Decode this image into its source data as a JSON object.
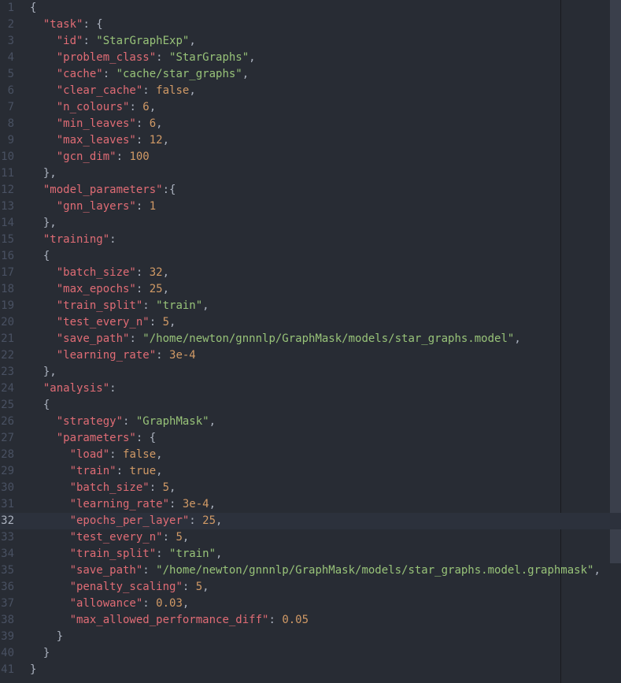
{
  "lines": [
    {
      "num": "1",
      "indent": 0,
      "tokens": [
        {
          "t": "{",
          "c": "p"
        }
      ]
    },
    {
      "num": "2",
      "indent": 1,
      "tokens": [
        {
          "t": "\"task\"",
          "c": "k"
        },
        {
          "t": ": {",
          "c": "p"
        }
      ]
    },
    {
      "num": "3",
      "indent": 2,
      "tokens": [
        {
          "t": "\"id\"",
          "c": "k"
        },
        {
          "t": ": ",
          "c": "p"
        },
        {
          "t": "\"StarGraphExp\"",
          "c": "s"
        },
        {
          "t": ",",
          "c": "p"
        }
      ]
    },
    {
      "num": "4",
      "indent": 2,
      "tokens": [
        {
          "t": "\"problem_class\"",
          "c": "k"
        },
        {
          "t": ": ",
          "c": "p"
        },
        {
          "t": "\"StarGraphs\"",
          "c": "s"
        },
        {
          "t": ",",
          "c": "p"
        }
      ]
    },
    {
      "num": "5",
      "indent": 2,
      "tokens": [
        {
          "t": "\"cache\"",
          "c": "k"
        },
        {
          "t": ": ",
          "c": "p"
        },
        {
          "t": "\"cache/star_graphs\"",
          "c": "s"
        },
        {
          "t": ",",
          "c": "p"
        }
      ]
    },
    {
      "num": "6",
      "indent": 2,
      "tokens": [
        {
          "t": "\"clear_cache\"",
          "c": "k"
        },
        {
          "t": ": ",
          "c": "p"
        },
        {
          "t": "false",
          "c": "n"
        },
        {
          "t": ",",
          "c": "p"
        }
      ]
    },
    {
      "num": "7",
      "indent": 2,
      "tokens": [
        {
          "t": "\"n_colours\"",
          "c": "k"
        },
        {
          "t": ": ",
          "c": "p"
        },
        {
          "t": "6",
          "c": "n"
        },
        {
          "t": ",",
          "c": "p"
        }
      ]
    },
    {
      "num": "8",
      "indent": 2,
      "tokens": [
        {
          "t": "\"min_leaves\"",
          "c": "k"
        },
        {
          "t": ": ",
          "c": "p"
        },
        {
          "t": "6",
          "c": "n"
        },
        {
          "t": ",",
          "c": "p"
        }
      ]
    },
    {
      "num": "9",
      "indent": 2,
      "tokens": [
        {
          "t": "\"max_leaves\"",
          "c": "k"
        },
        {
          "t": ": ",
          "c": "p"
        },
        {
          "t": "12",
          "c": "n"
        },
        {
          "t": ",",
          "c": "p"
        }
      ]
    },
    {
      "num": "10",
      "indent": 2,
      "tokens": [
        {
          "t": "\"gcn_dim\"",
          "c": "k"
        },
        {
          "t": ": ",
          "c": "p"
        },
        {
          "t": "100",
          "c": "n"
        }
      ]
    },
    {
      "num": "11",
      "indent": 1,
      "tokens": [
        {
          "t": "},",
          "c": "p"
        }
      ]
    },
    {
      "num": "12",
      "indent": 1,
      "tokens": [
        {
          "t": "\"model_parameters\"",
          "c": "k"
        },
        {
          "t": ":{",
          "c": "p"
        }
      ]
    },
    {
      "num": "13",
      "indent": 2,
      "tokens": [
        {
          "t": "\"gnn_layers\"",
          "c": "k"
        },
        {
          "t": ": ",
          "c": "p"
        },
        {
          "t": "1",
          "c": "n"
        }
      ]
    },
    {
      "num": "14",
      "indent": 1,
      "tokens": [
        {
          "t": "},",
          "c": "p"
        }
      ]
    },
    {
      "num": "15",
      "indent": 1,
      "tokens": [
        {
          "t": "\"training\"",
          "c": "k"
        },
        {
          "t": ":",
          "c": "p"
        }
      ]
    },
    {
      "num": "16",
      "indent": 1,
      "tokens": [
        {
          "t": "{",
          "c": "p"
        }
      ]
    },
    {
      "num": "17",
      "indent": 2,
      "tokens": [
        {
          "t": "\"batch_size\"",
          "c": "k"
        },
        {
          "t": ": ",
          "c": "p"
        },
        {
          "t": "32",
          "c": "n"
        },
        {
          "t": ",",
          "c": "p"
        }
      ]
    },
    {
      "num": "18",
      "indent": 2,
      "tokens": [
        {
          "t": "\"max_epochs\"",
          "c": "k"
        },
        {
          "t": ": ",
          "c": "p"
        },
        {
          "t": "25",
          "c": "n"
        },
        {
          "t": ",",
          "c": "p"
        }
      ]
    },
    {
      "num": "19",
      "indent": 2,
      "tokens": [
        {
          "t": "\"train_split\"",
          "c": "k"
        },
        {
          "t": ": ",
          "c": "p"
        },
        {
          "t": "\"train\"",
          "c": "s"
        },
        {
          "t": ",",
          "c": "p"
        }
      ]
    },
    {
      "num": "20",
      "indent": 2,
      "tokens": [
        {
          "t": "\"test_every_n\"",
          "c": "k"
        },
        {
          "t": ": ",
          "c": "p"
        },
        {
          "t": "5",
          "c": "n"
        },
        {
          "t": ",",
          "c": "p"
        }
      ]
    },
    {
      "num": "21",
      "indent": 2,
      "tokens": [
        {
          "t": "\"save_path\"",
          "c": "k"
        },
        {
          "t": ": ",
          "c": "p"
        },
        {
          "t": "\"/home/newton/gnnnlp/GraphMask/models/star_graphs.model\"",
          "c": "s"
        },
        {
          "t": ",",
          "c": "p"
        }
      ]
    },
    {
      "num": "22",
      "indent": 2,
      "tokens": [
        {
          "t": "\"learning_rate\"",
          "c": "k"
        },
        {
          "t": ": ",
          "c": "p"
        },
        {
          "t": "3e-4",
          "c": "n"
        }
      ]
    },
    {
      "num": "23",
      "indent": 1,
      "tokens": [
        {
          "t": "},",
          "c": "p"
        }
      ]
    },
    {
      "num": "24",
      "indent": 1,
      "tokens": [
        {
          "t": "\"analysis\"",
          "c": "k"
        },
        {
          "t": ":",
          "c": "p"
        }
      ]
    },
    {
      "num": "25",
      "indent": 1,
      "tokens": [
        {
          "t": "{",
          "c": "p"
        }
      ]
    },
    {
      "num": "26",
      "indent": 2,
      "tokens": [
        {
          "t": "\"strategy\"",
          "c": "k"
        },
        {
          "t": ": ",
          "c": "p"
        },
        {
          "t": "\"GraphMask\"",
          "c": "s"
        },
        {
          "t": ",",
          "c": "p"
        }
      ]
    },
    {
      "num": "27",
      "indent": 2,
      "tokens": [
        {
          "t": "\"parameters\"",
          "c": "k"
        },
        {
          "t": ": {",
          "c": "p"
        }
      ]
    },
    {
      "num": "28",
      "indent": 3,
      "tokens": [
        {
          "t": "\"load\"",
          "c": "k"
        },
        {
          "t": ": ",
          "c": "p"
        },
        {
          "t": "false",
          "c": "n"
        },
        {
          "t": ",",
          "c": "p"
        }
      ]
    },
    {
      "num": "29",
      "indent": 3,
      "tokens": [
        {
          "t": "\"train\"",
          "c": "k"
        },
        {
          "t": ": ",
          "c": "p"
        },
        {
          "t": "true",
          "c": "n"
        },
        {
          "t": ",",
          "c": "p"
        }
      ]
    },
    {
      "num": "30",
      "indent": 3,
      "tokens": [
        {
          "t": "\"batch_size\"",
          "c": "k"
        },
        {
          "t": ": ",
          "c": "p"
        },
        {
          "t": "5",
          "c": "n"
        },
        {
          "t": ",",
          "c": "p"
        }
      ]
    },
    {
      "num": "31",
      "indent": 3,
      "tokens": [
        {
          "t": "\"learning_rate\"",
          "c": "k"
        },
        {
          "t": ": ",
          "c": "p"
        },
        {
          "t": "3e-4",
          "c": "n"
        },
        {
          "t": ",",
          "c": "p"
        }
      ]
    },
    {
      "num": "32",
      "indent": 3,
      "hl": true,
      "tokens": [
        {
          "t": "\"epochs_per_layer\"",
          "c": "k"
        },
        {
          "t": ": ",
          "c": "p"
        },
        {
          "t": "25",
          "c": "n"
        },
        {
          "t": ",",
          "c": "p"
        }
      ]
    },
    {
      "num": "33",
      "indent": 3,
      "tokens": [
        {
          "t": "\"test_every_n\"",
          "c": "k"
        },
        {
          "t": ": ",
          "c": "p"
        },
        {
          "t": "5",
          "c": "n"
        },
        {
          "t": ",",
          "c": "p"
        }
      ]
    },
    {
      "num": "34",
      "indent": 3,
      "tokens": [
        {
          "t": "\"train_split\"",
          "c": "k"
        },
        {
          "t": ": ",
          "c": "p"
        },
        {
          "t": "\"train\"",
          "c": "s"
        },
        {
          "t": ",",
          "c": "p"
        }
      ]
    },
    {
      "num": "35",
      "indent": 3,
      "tokens": [
        {
          "t": "\"save_path\"",
          "c": "k"
        },
        {
          "t": ": ",
          "c": "p"
        },
        {
          "t": "\"/home/newton/gnnnlp/GraphMask/models/star_graphs.model.graphmask\"",
          "c": "s"
        },
        {
          "t": ",",
          "c": "p"
        }
      ]
    },
    {
      "num": "36",
      "indent": 3,
      "tokens": [
        {
          "t": "\"penalty_scaling\"",
          "c": "k"
        },
        {
          "t": ": ",
          "c": "p"
        },
        {
          "t": "5",
          "c": "n"
        },
        {
          "t": ",",
          "c": "p"
        }
      ]
    },
    {
      "num": "37",
      "indent": 3,
      "tokens": [
        {
          "t": "\"allowance\"",
          "c": "k"
        },
        {
          "t": ": ",
          "c": "p"
        },
        {
          "t": "0.03",
          "c": "n"
        },
        {
          "t": ",",
          "c": "p"
        }
      ]
    },
    {
      "num": "38",
      "indent": 3,
      "tokens": [
        {
          "t": "\"max_allowed_performance_diff\"",
          "c": "k"
        },
        {
          "t": ": ",
          "c": "p"
        },
        {
          "t": "0.05",
          "c": "n"
        }
      ]
    },
    {
      "num": "39",
      "indent": 2,
      "tokens": [
        {
          "t": "}",
          "c": "p"
        }
      ]
    },
    {
      "num": "40",
      "indent": 1,
      "tokens": [
        {
          "t": "}",
          "c": "p"
        }
      ]
    },
    {
      "num": "41",
      "indent": 0,
      "tokens": [
        {
          "t": "}",
          "c": "p"
        }
      ]
    }
  ]
}
